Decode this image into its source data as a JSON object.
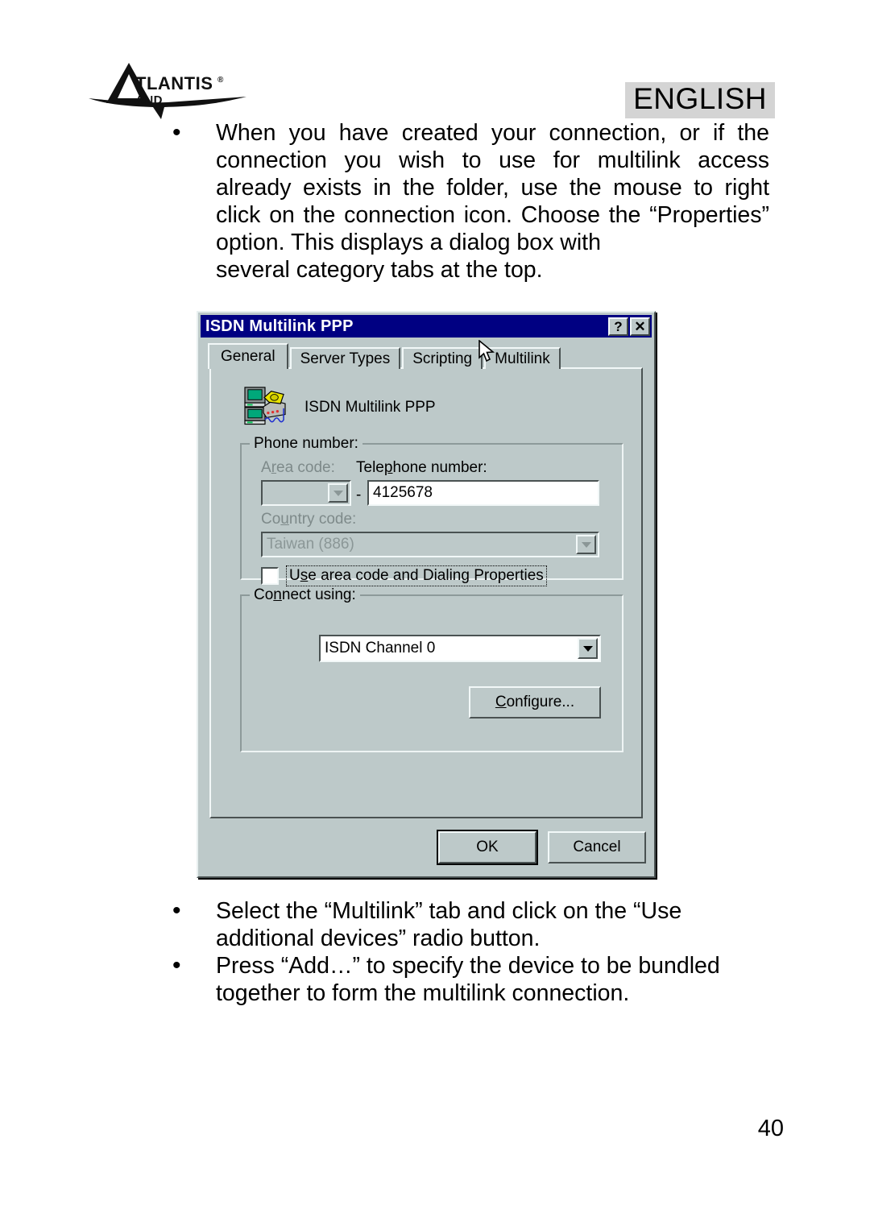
{
  "page": {
    "language_badge": "ENGLISH",
    "page_number": "40",
    "logo_text_main": "TLANTIS",
    "logo_text_sub": "AND",
    "logo_registered": "®",
    "background_color": "#ffffff"
  },
  "bullets": [
    {
      "marker": "•",
      "text": "When you have created your connection, or if the connection you wish to use for multilink access already exists in the folder, use the mouse to right click on the connection icon.  Choose the “Properties” option.  This displays a dialog box with",
      "last_line": "several category tabs at the top."
    },
    {
      "marker": "•",
      "text": "Select the “Multilink” tab and click on the “Use",
      "last_line": "additional devices” radio button."
    },
    {
      "marker": "•",
      "text": "Press “Add…” to specify the device to be bundled",
      "last_line": "together to form the multilink connection."
    }
  ],
  "dialog": {
    "title": "ISDN Multilink PPP",
    "titlebar_color": "#000082",
    "face_color": "#bdc9c9",
    "help_button": "?",
    "close_button": "✕",
    "tabs": [
      {
        "label": "General",
        "active": true
      },
      {
        "label": "Server Types",
        "active": false
      },
      {
        "label": "Scripting",
        "active": false
      },
      {
        "label": "Multilink",
        "active": false
      }
    ],
    "connection_name": "ISDN Multilink PPP",
    "phone_group": {
      "title": "Phone number:",
      "area_code_label": "Area code:",
      "area_code_value": "",
      "area_code_disabled": true,
      "separator": "-",
      "telephone_label": "Telephone number:",
      "telephone_value": "4125678",
      "country_code_label": "Country code:",
      "country_code_value": "Taiwan (886)",
      "country_code_disabled": true,
      "checkbox_label": "Use area code and Dialing Properties",
      "checkbox_checked": false
    },
    "connect_group": {
      "title": "Connect using:",
      "device_value": "ISDN Channel 0",
      "configure_button": "Configure..."
    },
    "ok_button": "OK",
    "cancel_button": "Cancel"
  }
}
